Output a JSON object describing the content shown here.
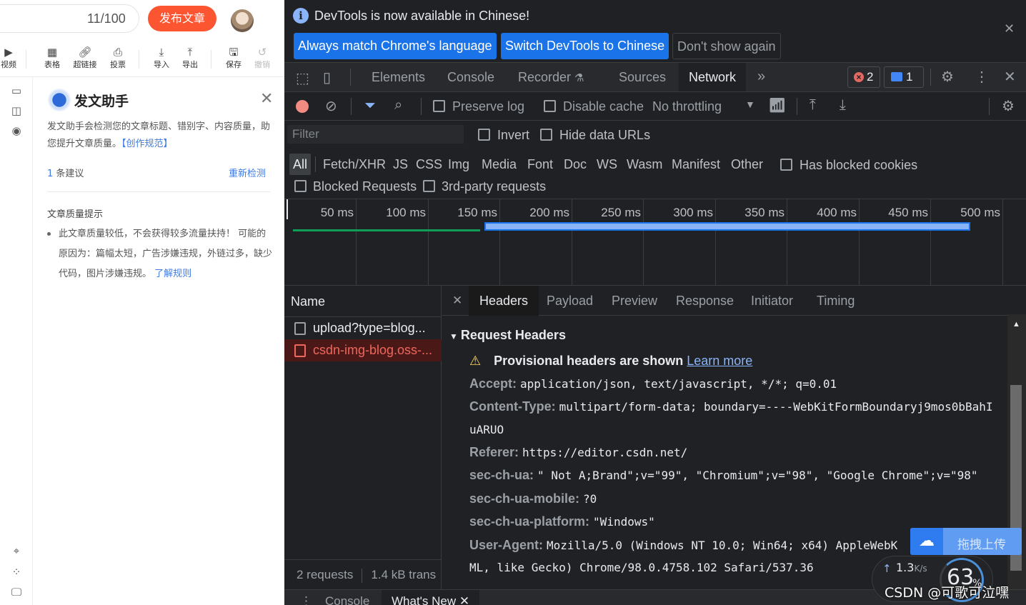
{
  "editor": {
    "title_counter": "11/100",
    "publish_label": "发布文章",
    "toolbar": [
      {
        "label": "视频",
        "icon": "video-icon"
      },
      {
        "label": "表格",
        "icon": "table-icon"
      },
      {
        "label": "超链接",
        "icon": "link-icon"
      },
      {
        "label": "投票",
        "icon": "vote-icon"
      },
      {
        "label": "导入",
        "icon": "import-icon"
      },
      {
        "label": "导出",
        "icon": "export-icon"
      },
      {
        "label": "保存",
        "icon": "save-icon"
      },
      {
        "label": "撤销",
        "icon": "undo-icon"
      }
    ],
    "assistant": {
      "title": "发文助手",
      "desc": "发文助手会检测您的文章标题、错别字、内容质量，助您提升文章质量。",
      "desc_link": "【创作规范】",
      "suggestion_count": "1",
      "suggestion_label": "条建议",
      "recheck_label": "重新检测",
      "quality_title": "文章质量提示",
      "quality_text": "此文章质量较低，不会获得较多流量扶持！ 可能的原因为：篇幅太短，广告涉嫌违规，外链过多，缺少代码，图片涉嫌违规。",
      "quality_link": "了解规则"
    }
  },
  "devtools": {
    "infobar": {
      "text": "DevTools is now available in Chinese!",
      "btn_match": "Always match Chrome's language",
      "btn_switch": "Switch DevTools to Chinese",
      "btn_dismiss": "Don't show again"
    },
    "tabs": [
      "Elements",
      "Console",
      "Recorder",
      "Sources",
      "Network"
    ],
    "error_count": "2",
    "message_count": "1",
    "controls": {
      "preserve_log": "Preserve log",
      "disable_cache": "Disable cache",
      "throttling": "No throttling"
    },
    "filter": {
      "placeholder": "Filter",
      "invert": "Invert",
      "hide_data_urls": "Hide data URLs"
    },
    "types": [
      "All",
      "Fetch/XHR",
      "JS",
      "CSS",
      "Img",
      "Media",
      "Font",
      "Doc",
      "WS",
      "Wasm",
      "Manifest",
      "Other"
    ],
    "has_blocked_cookies": "Has blocked cookies",
    "blocked_requests": "Blocked Requests",
    "third_party": "3rd-party requests",
    "timeline_ticks": [
      "50 ms",
      "100 ms",
      "150 ms",
      "200 ms",
      "250 ms",
      "300 ms",
      "350 ms",
      "400 ms",
      "450 ms",
      "500 ms"
    ],
    "request_list": {
      "header": "Name",
      "items": [
        "upload?type=blog...",
        "csdn-img-blog.oss-..."
      ],
      "status_requests": "2 requests",
      "status_transferred": "1.4 kB trans"
    },
    "detail_tabs": [
      "Headers",
      "Payload",
      "Preview",
      "Response",
      "Initiator",
      "Timing"
    ],
    "request_headers": {
      "section": "Request Headers",
      "warning": "Provisional headers are shown",
      "learn_more": "Learn more",
      "rows": [
        {
          "key": "Accept:",
          "value": "application/json, text/javascript, */*; q=0.01"
        },
        {
          "key": "Content-Type:",
          "value": "multipart/form-data; boundary=----WebKitFormBoundaryj9mos0bBahI"
        },
        {
          "key": "",
          "value": "uARUO"
        },
        {
          "key": "Referer:",
          "value": "https://editor.csdn.net/"
        },
        {
          "key": "sec-ch-ua:",
          "value": "\" Not A;Brand\";v=\"99\", \"Chromium\";v=\"98\", \"Google Chrome\";v=\"98\""
        },
        {
          "key": "sec-ch-ua-mobile:",
          "value": "?0"
        },
        {
          "key": "sec-ch-ua-platform:",
          "value": "\"Windows\""
        },
        {
          "key": "User-Agent:",
          "value": "Mozilla/5.0 (Windows NT 10.0; Win64; x64) AppleWebK"
        },
        {
          "key": "",
          "value": "ML, like Gecko) Chrome/98.0.4758.102 Safari/537.36"
        }
      ]
    },
    "drawer": {
      "console": "Console",
      "whats_new": "What's New"
    }
  },
  "overlay": {
    "upload_label": "拖拽上传",
    "speed": "1.3",
    "speed_unit": "K/s",
    "percent": "63",
    "watermark": "CSDN @可歌可泣嘿"
  }
}
